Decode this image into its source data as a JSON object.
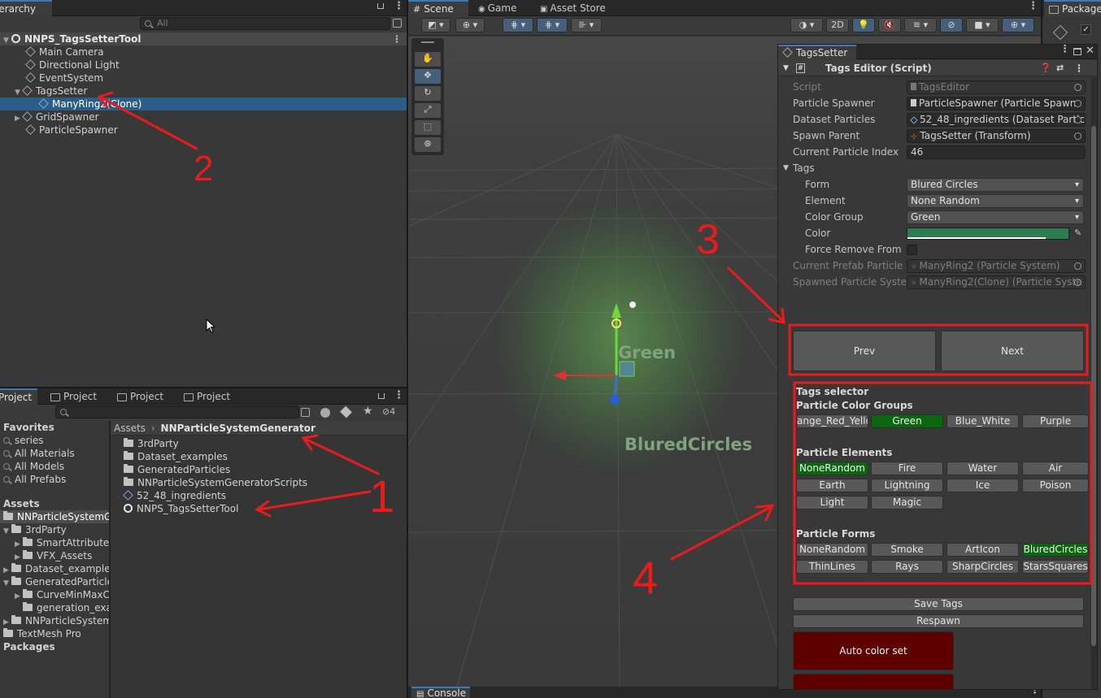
{
  "hierarchy": {
    "tab": "Hierarchy",
    "search_placeholder": "All",
    "scene": "NNPS_TagsSetterTool",
    "items": [
      {
        "label": "Main Camera"
      },
      {
        "label": "Directional Light"
      },
      {
        "label": "EventSystem"
      },
      {
        "label": "TagsSetter"
      },
      {
        "label": "ManyRing2(Clone)"
      },
      {
        "label": "GridSpawner"
      },
      {
        "label": "ParticleSpawner"
      }
    ]
  },
  "project": {
    "tabs": [
      "Project",
      "Project",
      "Project",
      "Project"
    ],
    "hidden_count": "4",
    "favorites": {
      "label": "Favorites",
      "items": [
        "series",
        "All Materials",
        "All Models",
        "All Prefabs"
      ]
    },
    "tree": [
      "Assets",
      "NNParticleSystemGenerator",
      "3rdParty",
      "SmartAttributes",
      "VFX_Assets",
      "Dataset_examples",
      "GeneratedParticles",
      "CurveMinMaxC",
      "generation_exa",
      "NNParticleSystemG",
      "TextMesh Pro",
      "Packages"
    ],
    "breadcrumb": [
      "Assets",
      "NNParticleSystemGenerator"
    ],
    "files": [
      "3rdParty",
      "Dataset_examples",
      "GeneratedParticles",
      "NNParticleSystemGeneratorScripts",
      "52_48_ingredients",
      "NNPS_TagsSetterTool"
    ]
  },
  "scene_view": {
    "tabs": [
      "Scene",
      "Game",
      "Asset Store"
    ],
    "mode_2d": "2D",
    "label_color": "Green",
    "label_form": "BluredCircles"
  },
  "console_tab": "Console",
  "package_tab": "Package",
  "inspector": {
    "tab": "TagsSetter",
    "component": "Tags Editor (Script)",
    "fields": [
      {
        "label": "Script",
        "value": "TagsEditor"
      },
      {
        "label": "Particle Spawner",
        "value": "ParticleSpawner (Particle Spawn"
      },
      {
        "label": "Dataset Particles",
        "value": "52_48_ingredients (Dataset Partic"
      },
      {
        "label": "Spawn Parent",
        "value": "TagsSetter (Transform)"
      },
      {
        "label": "Current Particle Index",
        "value": "46"
      }
    ],
    "tags_label": "Tags",
    "tags": [
      {
        "label": "Form",
        "value": "Blured Circles"
      },
      {
        "label": "Element",
        "value": "None Random"
      },
      {
        "label": "Color Group",
        "value": "Green"
      },
      {
        "label": "Color",
        "value": ""
      },
      {
        "label": "Force Remove From D",
        "value": ""
      }
    ],
    "color_value": "#2e7d52",
    "prefab_fields": [
      {
        "label": "Current Prefab Particle S",
        "value": "ManyRing2 (Particle System)"
      },
      {
        "label": "Spawned Particle Syster",
        "value": "ManyRing2(Clone) (Particle Syste"
      }
    ],
    "prev": "Prev",
    "next": "Next",
    "selector_title": "Tags selector",
    "color_groups_title": "Particle Color Groups",
    "color_groups": [
      "ange_Red_Yello",
      "Green",
      "Blue_White",
      "Purple"
    ],
    "elements_title": "Particle Elements",
    "elements": [
      "NoneRandom",
      "Fire",
      "Water",
      "Air",
      "Earth",
      "Lightning",
      "Ice",
      "Poison",
      "Light",
      "Magic"
    ],
    "forms_title": "Particle Forms",
    "forms": [
      "NoneRandom",
      "Smoke",
      "ArtIcon",
      "BluredCircles",
      "ThinLines",
      "Rays",
      "SharpCircles",
      "StarsSquares"
    ],
    "save_tags": "Save Tags",
    "respawn": "Respawn",
    "auto_color": "Auto color set",
    "selected_color": "#0b6610",
    "auto_color_bg": "#5f0000"
  },
  "annotations": [
    "2",
    "1",
    "3",
    "4"
  ]
}
